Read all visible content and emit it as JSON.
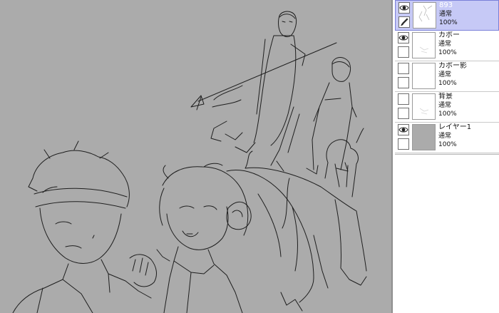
{
  "layers": [
    {
      "name": "893",
      "blend": "通常",
      "opacity": "100%",
      "visible": true,
      "brush": true,
      "selected": true,
      "thumb": "sketch"
    },
    {
      "name": "カボー",
      "blend": "通常",
      "opacity": "100%",
      "visible": true,
      "brush": false,
      "selected": false,
      "thumb": "faint"
    },
    {
      "name": "カボー影",
      "blend": "通常",
      "opacity": "100%",
      "visible": false,
      "brush": false,
      "selected": false,
      "thumb": "blank"
    },
    {
      "name": "背景",
      "blend": "通常",
      "opacity": "100%",
      "visible": false,
      "brush": false,
      "selected": false,
      "thumb": "faint"
    },
    {
      "name": "レイヤー1",
      "blend": "通常",
      "opacity": "100%",
      "visible": true,
      "brush": false,
      "selected": false,
      "thumb": "gray"
    }
  ],
  "icons": {
    "visibility": "eye-icon",
    "brush": "brush-icon"
  },
  "colors": {
    "canvas_background": "#ababab",
    "selected_layer": "#c6c9f6",
    "line_art": "#1e1e1e"
  }
}
